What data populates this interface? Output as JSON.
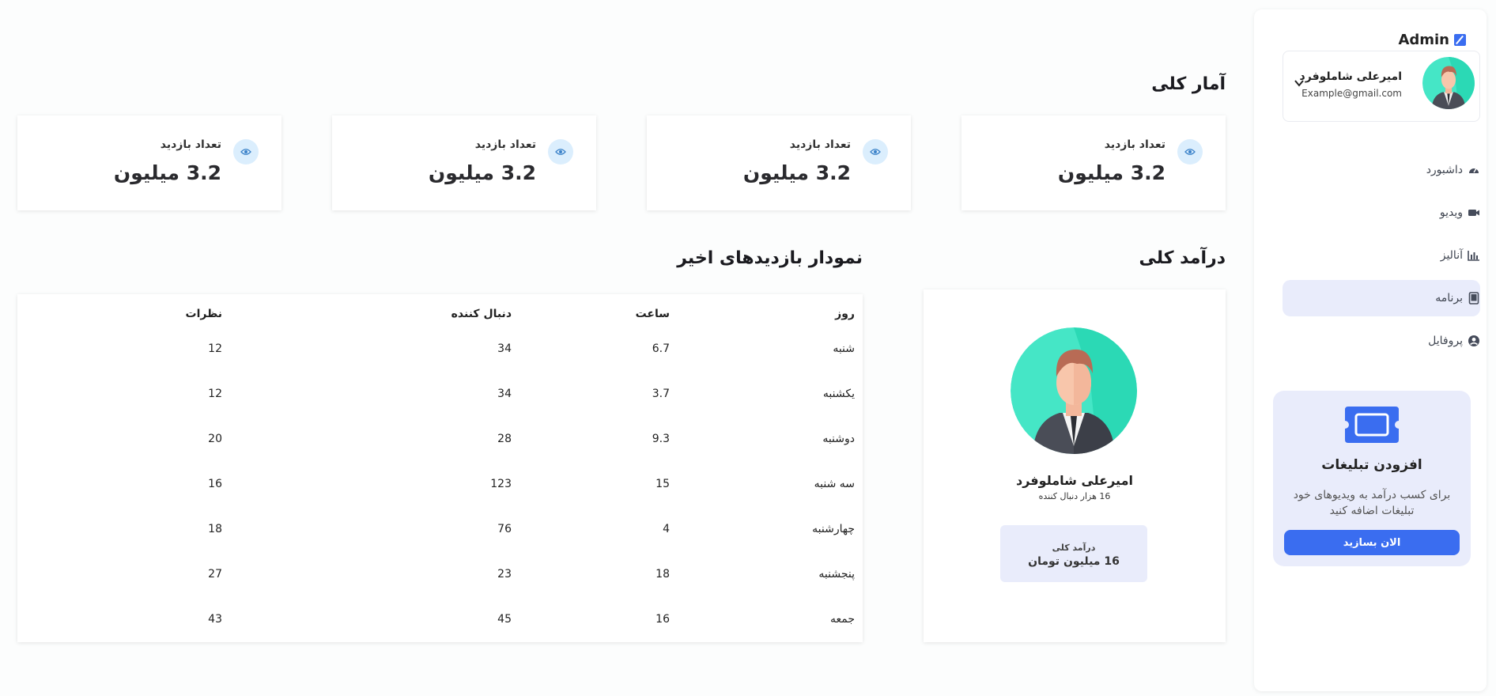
{
  "sidebar": {
    "brand": "Admin",
    "profile": {
      "name": "امیرعلی شاملوفرد",
      "email": "Example@gmail.com"
    },
    "nav": [
      {
        "label": "داشبورد",
        "icon": "dashboard-icon",
        "active": false
      },
      {
        "label": "ویدیو",
        "icon": "video-icon",
        "active": false
      },
      {
        "label": "آنالیز",
        "icon": "analytics-icon",
        "active": false
      },
      {
        "label": "برنامه",
        "icon": "tablet-icon",
        "active": true
      },
      {
        "label": "پروفایل",
        "icon": "user-circle-icon",
        "active": false
      }
    ],
    "promo": {
      "title": "افزودن تبلیغات",
      "description": "برای کسب درآمد به ویدیوهای خود تبلیغات اضافه کنید",
      "button": "الان بسازید"
    }
  },
  "overview": {
    "title": "آمار کلی",
    "stats": [
      {
        "label": "تعداد بازدید",
        "value": "3.2 میلیون"
      },
      {
        "label": "تعداد بازدید",
        "value": "3.2 میلیون"
      },
      {
        "label": "تعداد بازدید",
        "value": "3.2 میلیون"
      },
      {
        "label": "تعداد بازدید",
        "value": "3.2 میلیون"
      }
    ]
  },
  "income": {
    "title": "درآمد کلی",
    "name": "امیرعلی شاملوفرد",
    "followers": "16 هزار دنبال کننده",
    "box_label": "درآمد کلی",
    "box_value": "16 میلیون تومان"
  },
  "visits": {
    "title": "نمودار بازدیدهای اخیر",
    "headers": [
      "روز",
      "ساعت",
      "دنبال کننده",
      "نظرات"
    ],
    "rows": [
      [
        "شنبه",
        "6.7",
        "34",
        "12"
      ],
      [
        "یکشنبه",
        "3.7",
        "34",
        "12"
      ],
      [
        "دوشنبه",
        "9.3",
        "28",
        "20"
      ],
      [
        "سه شنبه",
        "15",
        "123",
        "16"
      ],
      [
        "چهارشنبه",
        "4",
        "76",
        "18"
      ],
      [
        "پنجشنبه",
        "18",
        "23",
        "27"
      ],
      [
        "جمعه",
        "16",
        "45",
        "43"
      ]
    ]
  },
  "colors": {
    "accent": "#3a6df0",
    "soft_accent": "#e9ecfb",
    "avatar_bg": "#3de0c3"
  }
}
